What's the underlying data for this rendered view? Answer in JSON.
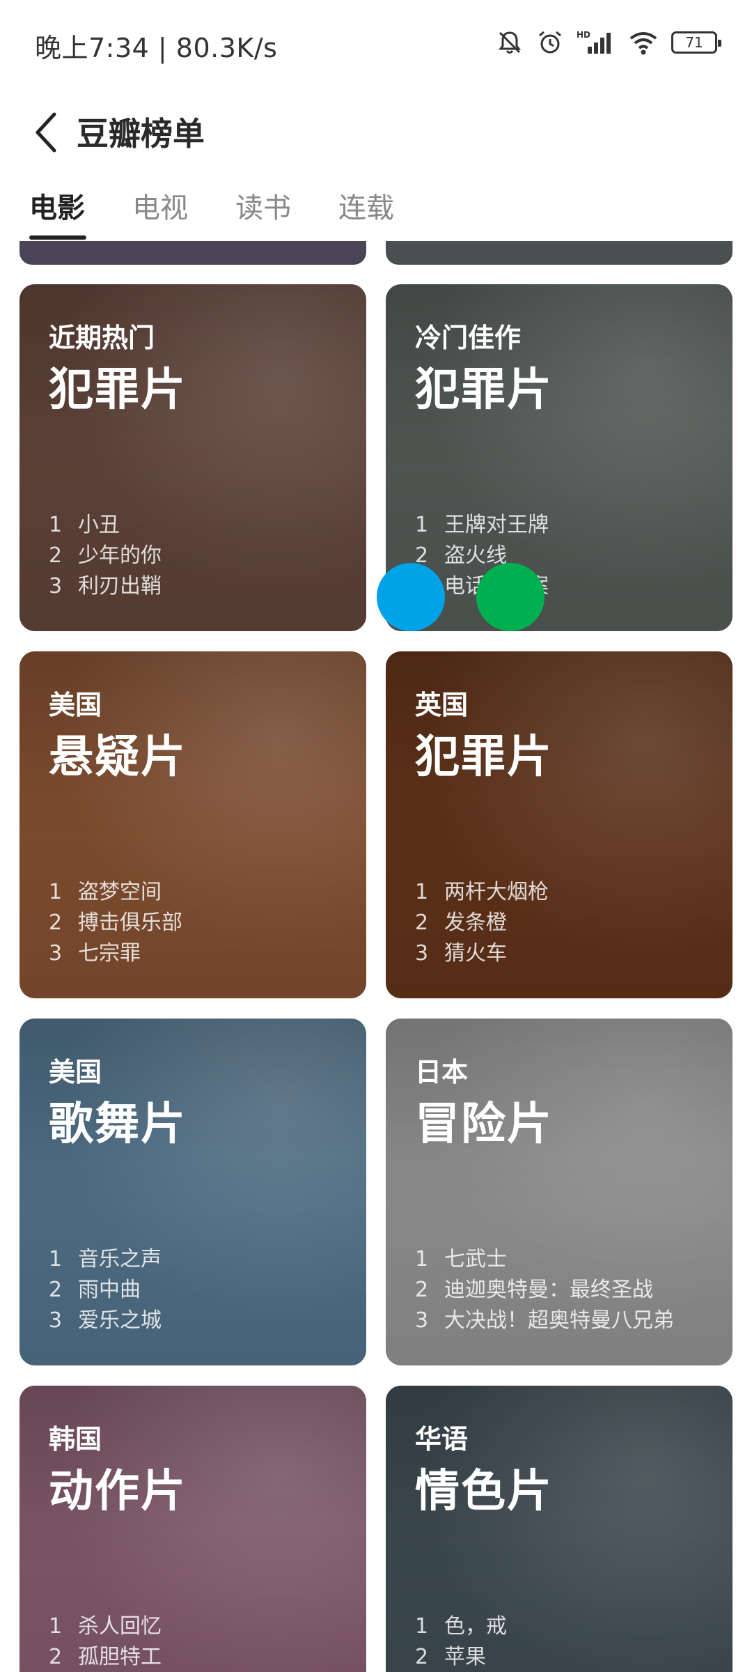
{
  "status_bar": {
    "time": "晚上7:34 | 80.3K/s",
    "battery": "71",
    "icons": [
      "bell-off-icon",
      "alarm-icon",
      "hd-signal-icon",
      "wifi-icon",
      "battery-icon"
    ]
  },
  "header": {
    "title": "豆瓣榜单",
    "back_icon": "chevron-left-icon"
  },
  "tabs": [
    {
      "label": "电影",
      "active": true
    },
    {
      "label": "电视",
      "active": false
    },
    {
      "label": "读书",
      "active": false
    },
    {
      "label": "连载",
      "active": false
    }
  ],
  "cards": [
    {
      "subtitle": "近期热门",
      "title": "犯罪片",
      "color": "#5b4036",
      "items": [
        {
          "rank": "1",
          "name": "小丑"
        },
        {
          "rank": "2",
          "name": "少年的你"
        },
        {
          "rank": "3",
          "name": "利刃出鞘"
        }
      ]
    },
    {
      "subtitle": "冷门佳作",
      "title": "犯罪片",
      "color": "#4f5652",
      "items": [
        {
          "rank": "1",
          "name": "王牌对王牌"
        },
        {
          "rank": "2",
          "name": "盗火线"
        },
        {
          "rank": "3",
          "name": "电话谋杀案"
        }
      ]
    },
    {
      "subtitle": "美国",
      "title": "悬疑片",
      "color": "#7c4b2e",
      "items": [
        {
          "rank": "1",
          "name": "盗梦空间"
        },
        {
          "rank": "2",
          "name": "搏击俱乐部"
        },
        {
          "rank": "3",
          "name": "七宗罪"
        }
      ]
    },
    {
      "subtitle": "英国",
      "title": "犯罪片",
      "color": "#5c3018",
      "items": [
        {
          "rank": "1",
          "name": "两杆大烟枪"
        },
        {
          "rank": "2",
          "name": "发条橙"
        },
        {
          "rank": "3",
          "name": "猜火车"
        }
      ]
    },
    {
      "subtitle": "美国",
      "title": "歌舞片",
      "color": "#4d6b82",
      "items": [
        {
          "rank": "1",
          "name": "音乐之声"
        },
        {
          "rank": "2",
          "name": "雨中曲"
        },
        {
          "rank": "3",
          "name": "爱乐之城"
        }
      ]
    },
    {
      "subtitle": "日本",
      "title": "冒险片",
      "color": "#8a8a8a",
      "items": [
        {
          "rank": "1",
          "name": "七武士"
        },
        {
          "rank": "2",
          "name": "迪迦奥特曼：最终圣战"
        },
        {
          "rank": "3",
          "name": "大决战！超奥特曼八兄弟"
        }
      ]
    },
    {
      "subtitle": "韩国",
      "title": "动作片",
      "color": "#7b5566",
      "items": [
        {
          "rank": "1",
          "name": "杀人回忆"
        },
        {
          "rank": "2",
          "name": "孤胆特工"
        }
      ]
    },
    {
      "subtitle": "华语",
      "title": "情色片",
      "color": "#3b474e",
      "items": [
        {
          "rank": "1",
          "name": "色，戒"
        },
        {
          "rank": "2",
          "name": "苹果"
        }
      ]
    }
  ],
  "colors": {
    "peek_left": "#4a4457",
    "peek_right": "#4a5052",
    "dot_blue": "#00a3e8",
    "dot_green": "#00b050"
  }
}
